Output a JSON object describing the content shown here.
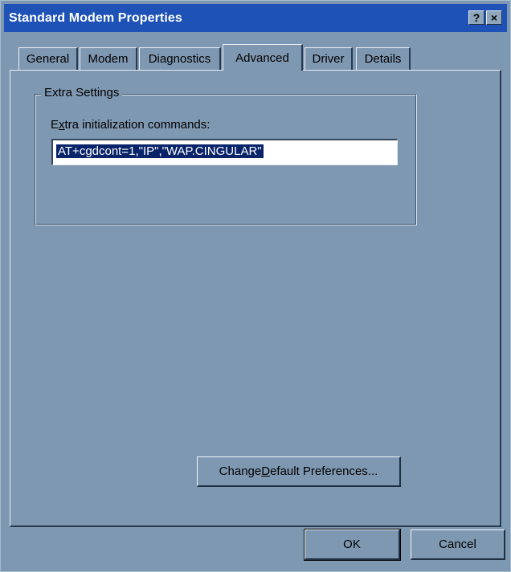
{
  "window": {
    "title": "Standard Modem Properties",
    "help_button": "?",
    "close_button": "×"
  },
  "tabs": [
    {
      "label": "General"
    },
    {
      "label": "Modem"
    },
    {
      "label": "Diagnostics"
    },
    {
      "label": "Advanced",
      "selected": true
    },
    {
      "label": "Driver"
    },
    {
      "label": "Details"
    }
  ],
  "extra_settings": {
    "group_label": "Extra Settings",
    "field_label_prefix": "E",
    "field_label_accel": "x",
    "field_label_rest": "tra initialization commands:",
    "commands_value": "AT+cgdcont=1,\"IP\",\"WAP.CINGULAR\""
  },
  "buttons": {
    "change_prefs_prefix": "Change ",
    "change_prefs_accel": "D",
    "change_prefs_rest": "efault Preferences...",
    "ok": "OK",
    "cancel": "Cancel"
  }
}
